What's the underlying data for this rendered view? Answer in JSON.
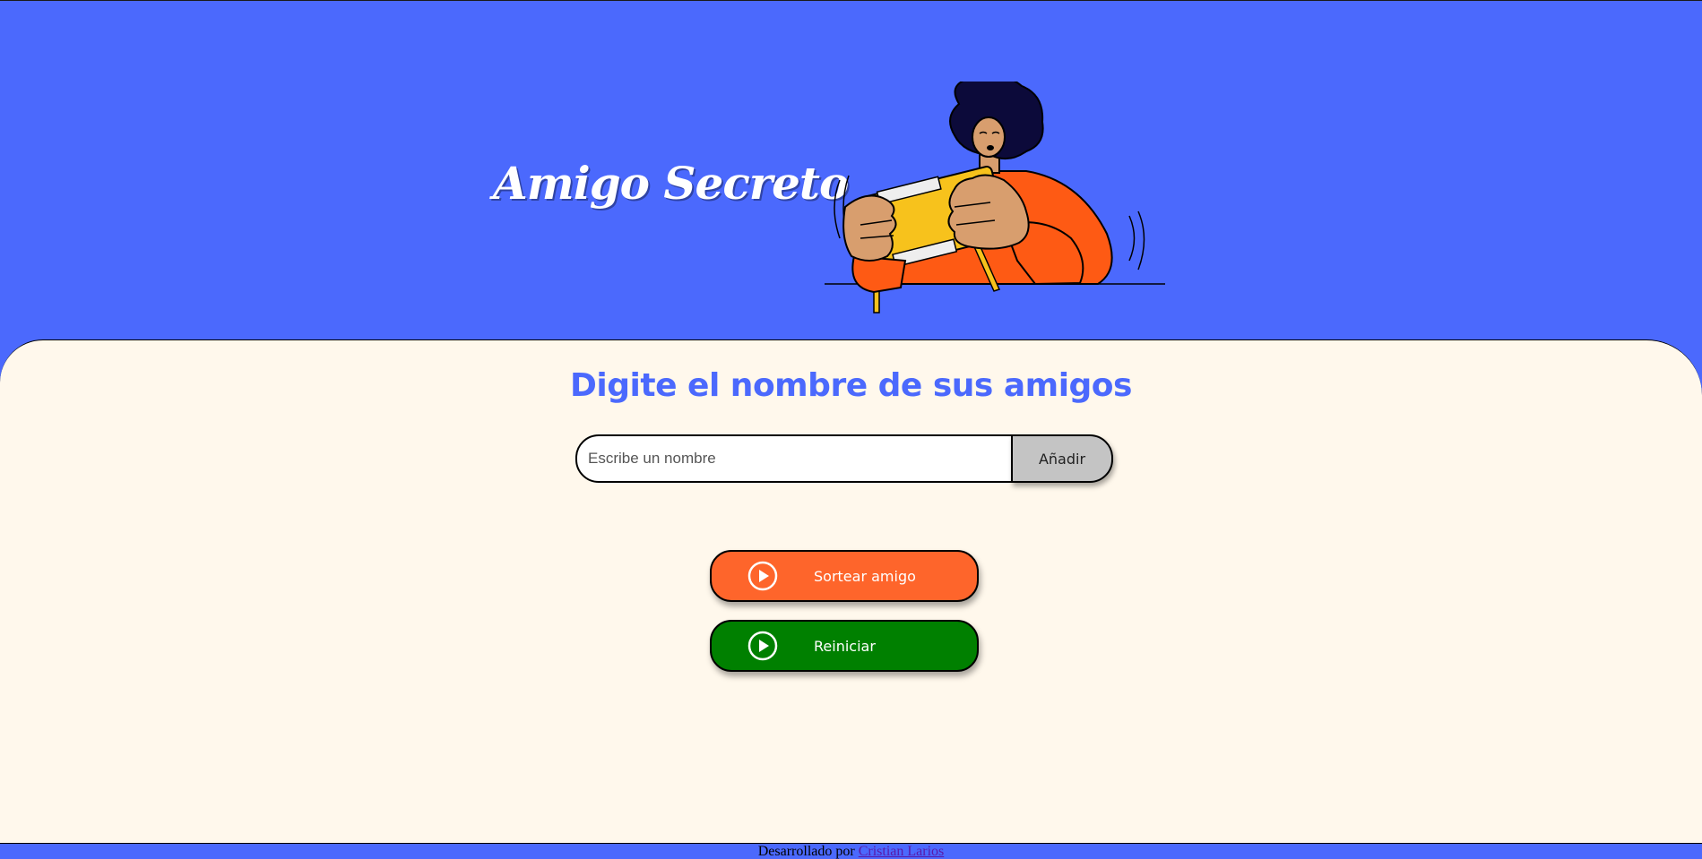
{
  "header": {
    "title": "Amigo Secreto"
  },
  "main": {
    "heading": "Digite el nombre de sus amigos",
    "input_placeholder": "Escribe un nombre",
    "add_label": "Añadir",
    "draw_label": "Sortear amigo",
    "reset_label": "Reiniciar"
  },
  "footer": {
    "text": "Desarrollado por",
    "author": "Cristian Larios"
  },
  "colors": {
    "header_bg": "#4b69fd",
    "main_bg": "#fff8ec",
    "heading": "#4b69fd",
    "draw_button": "#fe652b",
    "reset_button": "#008000",
    "add_button": "#c4c4c4"
  },
  "icons": {
    "action_icon": "play-circle-icon"
  }
}
